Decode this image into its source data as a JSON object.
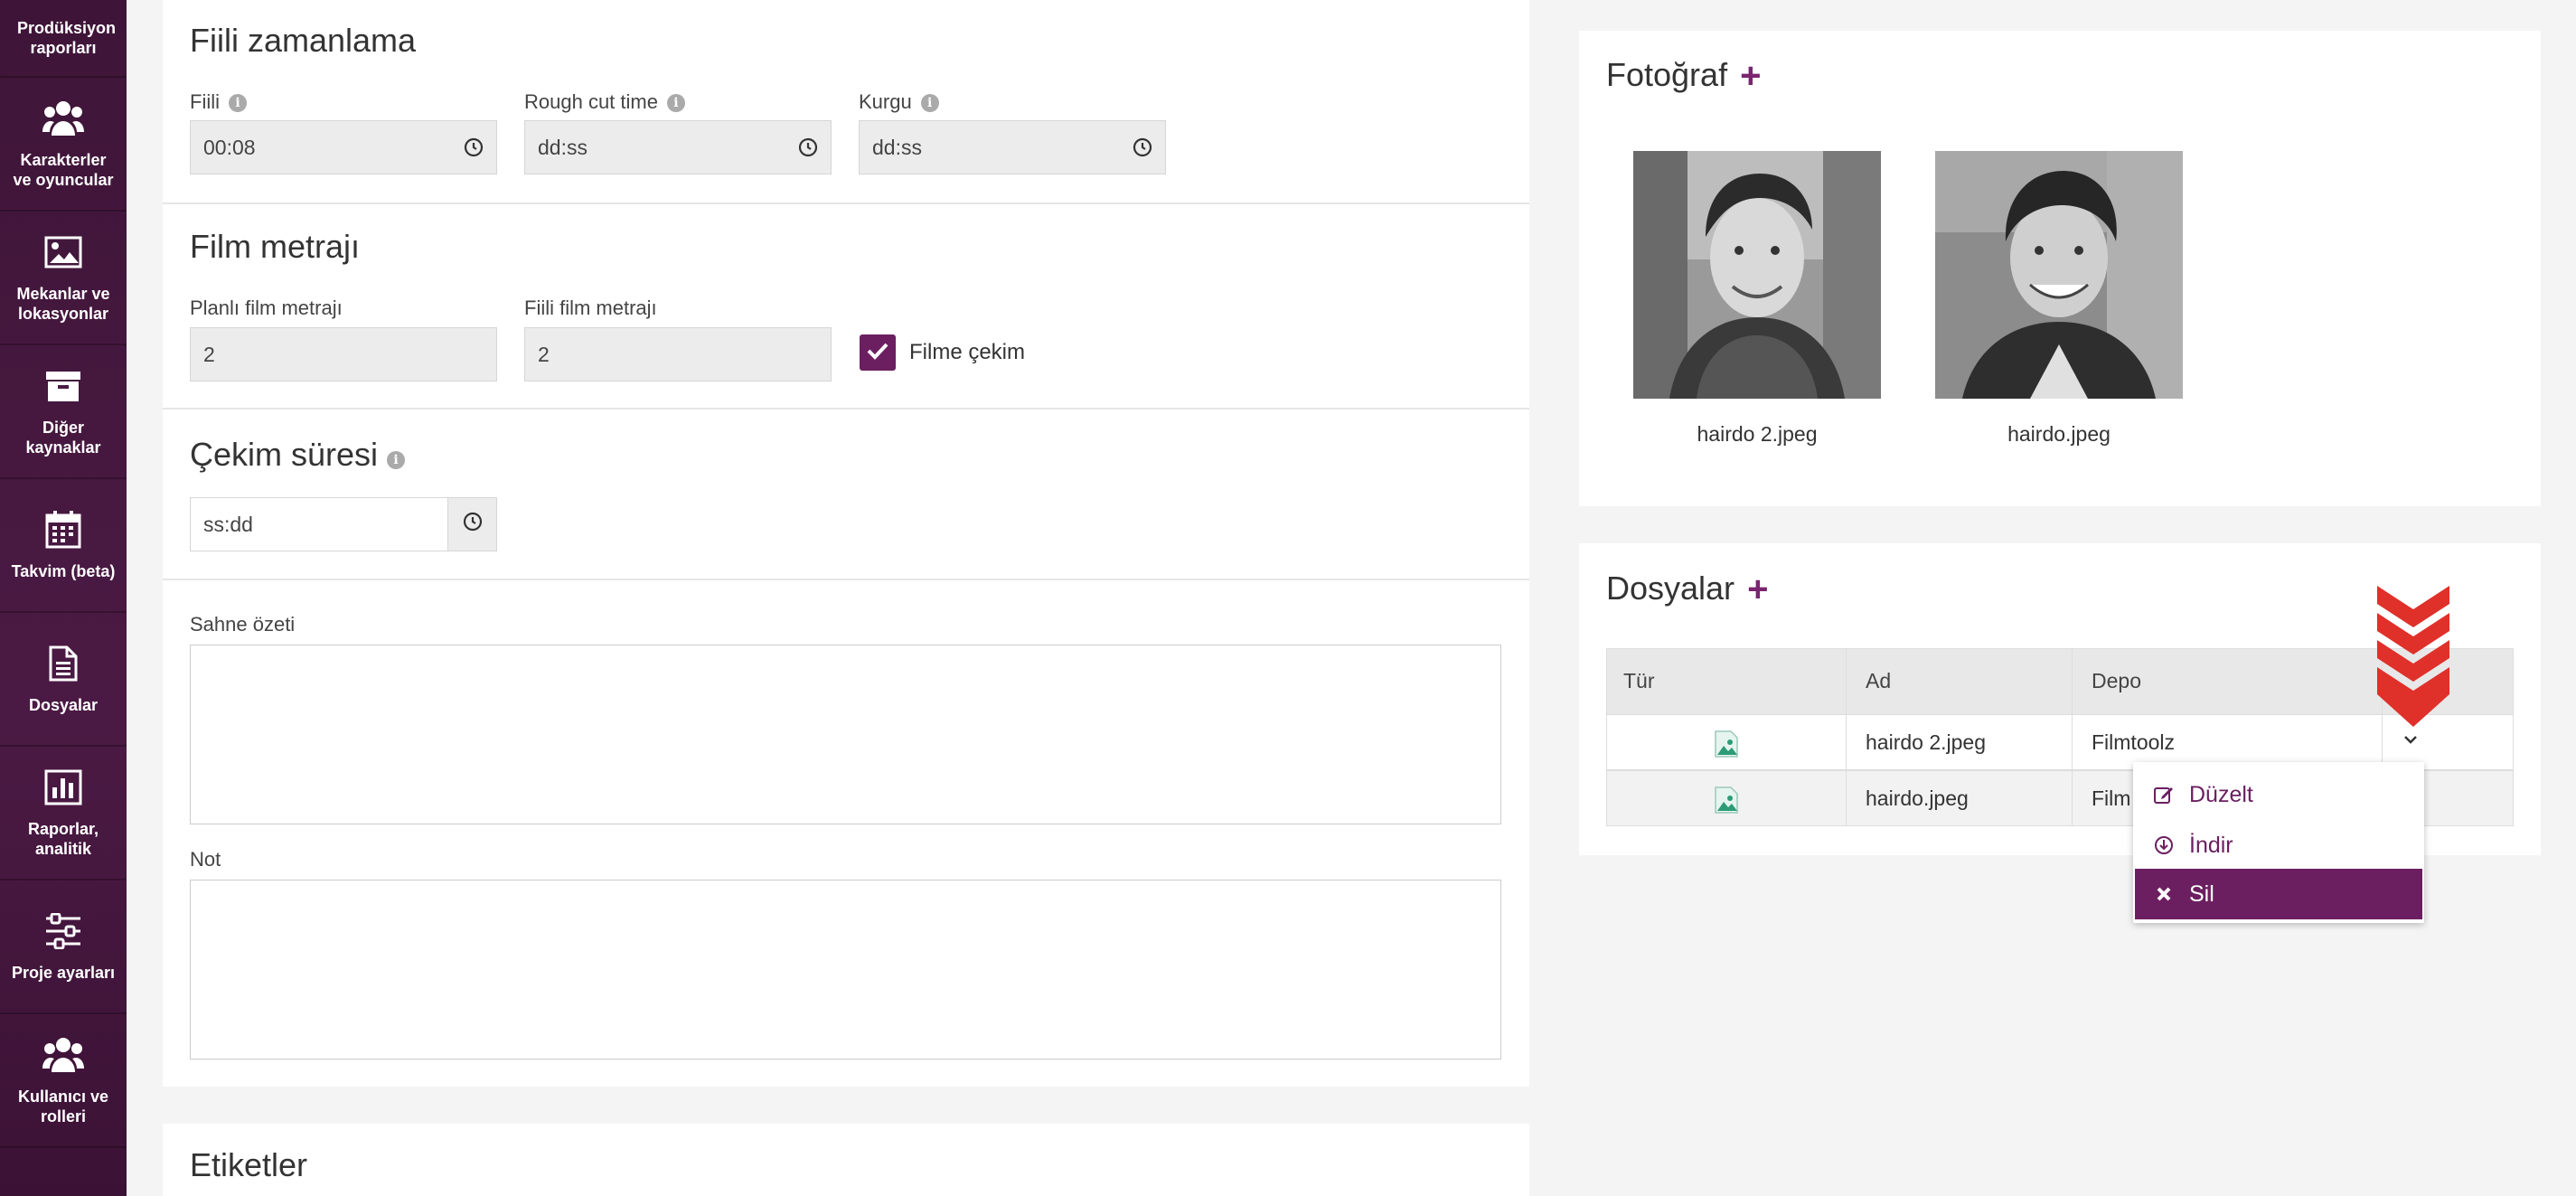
{
  "sidebar": {
    "items": [
      {
        "label": "Prodüksiyon raporları",
        "icon": "report-icon"
      },
      {
        "label": "Karakterler ve oyuncular",
        "icon": "users-icon"
      },
      {
        "label": "Mekanlar ve lokasyonlar",
        "icon": "image-icon"
      },
      {
        "label": "Diğer kaynaklar",
        "icon": "archive-icon"
      },
      {
        "label": "Takvim (beta)",
        "icon": "calendar-icon"
      },
      {
        "label": "Dosyalar",
        "icon": "document-icon"
      },
      {
        "label": "Raporlar, analitik",
        "icon": "bar-chart-icon"
      },
      {
        "label": "Proje ayarları",
        "icon": "sliders-icon"
      },
      {
        "label": "Kullanıcı ve rolleri",
        "icon": "users-icon"
      }
    ]
  },
  "timing": {
    "title": "Fiili zamanlama",
    "fields": [
      {
        "label": "Fiili",
        "value": "00:08"
      },
      {
        "label": "Rough cut time",
        "value": "dd:ss"
      },
      {
        "label": "Kurgu",
        "value": "dd:ss"
      }
    ]
  },
  "footage": {
    "title": "Film metrajı",
    "planned_label": "Planlı film metrajı",
    "planned_value": "2",
    "actual_label": "Fiili film metrajı",
    "actual_value": "2",
    "checkbox_label": "Filme çekim",
    "checkbox_checked": true
  },
  "shooting": {
    "title": "Çekim süresi",
    "value": "ss:dd"
  },
  "summary": {
    "label": "Sahne özeti",
    "value": ""
  },
  "note": {
    "label": "Not",
    "value": ""
  },
  "tags": {
    "title": "Etiketler"
  },
  "photos": {
    "title": "Fotoğraf",
    "plus": "+",
    "items": [
      {
        "name": "hairdo 2.jpeg"
      },
      {
        "name": "hairdo.jpeg"
      }
    ]
  },
  "files": {
    "title": "Dosyalar",
    "plus": "+",
    "columns": [
      "Tür",
      "Ad",
      "Depo"
    ],
    "rows": [
      {
        "name": "hairdo 2.jpeg",
        "storage": "Filmtoolz"
      },
      {
        "name": "hairdo.jpeg",
        "storage": "Film"
      }
    ]
  },
  "context_menu": {
    "items": [
      {
        "label": "Düzelt",
        "icon": "edit-icon"
      },
      {
        "label": "İndir",
        "icon": "download-icon"
      },
      {
        "label": "Sil",
        "icon": "close-icon"
      }
    ],
    "active_index": 2
  },
  "colors": {
    "accent": "#6b1f60",
    "sidebar": "#4b1a44",
    "arrow": "#e0302a"
  }
}
